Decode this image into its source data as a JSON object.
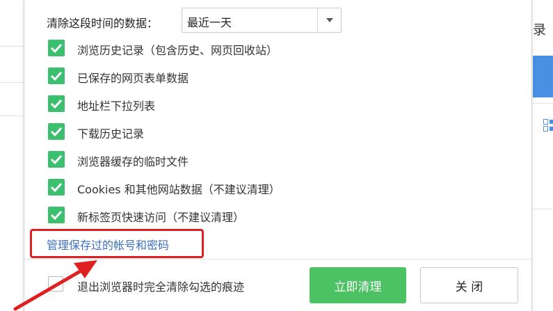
{
  "background": {
    "right_text": "录",
    "accent_color": "#4a90e2"
  },
  "dialog": {
    "range_label": "清除这段时间的数据：",
    "range_select": {
      "value": "最近一天",
      "arrow_icon": "dropdown-triangle-icon"
    },
    "options": [
      {
        "label": "浏览历史记录（包含历史、网页回收站）",
        "checked": true
      },
      {
        "label": "已保存的网页表单数据",
        "checked": true
      },
      {
        "label": "地址栏下拉列表",
        "checked": true
      },
      {
        "label": "下载历史记录",
        "checked": true
      },
      {
        "label": "浏览器缓存的临时文件",
        "checked": true
      },
      {
        "label": "Cookies 和其他网站数据（不建议清理）",
        "checked": true
      },
      {
        "label": "新标签页快速访问（不建议清理）",
        "checked": true
      }
    ],
    "manage_link": "管理保存过的帐号和密码",
    "exit_checkbox": {
      "label": "退出浏览器时完全清除勾选的痕迹",
      "checked": false
    },
    "clear_button": "立即清理",
    "close_button": "关 闭",
    "colors": {
      "checkbox_green": "#3cc070",
      "primary_button": "#4cc263",
      "link_blue": "#3b6fc2",
      "annotation_red": "#e02020"
    }
  }
}
